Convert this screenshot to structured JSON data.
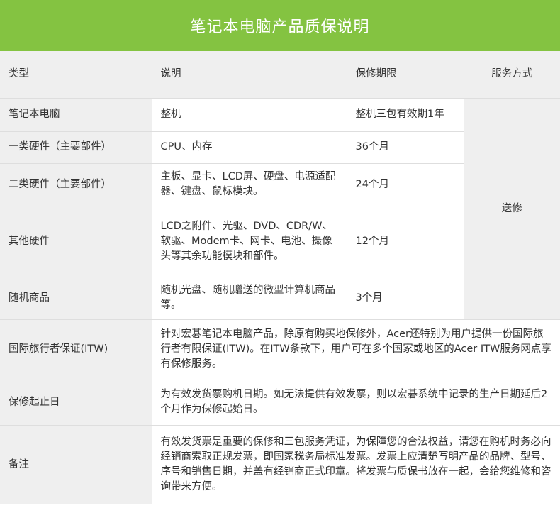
{
  "title": "笔记本电脑产品质保说明",
  "headers": {
    "type": "类型",
    "desc": "说明",
    "period": "保修期限",
    "service": "服务方式"
  },
  "rows": [
    {
      "type": "笔记本电脑",
      "desc": "整机",
      "period": "整机三包有效期1年"
    },
    {
      "type": "一类硬件（主要部件）",
      "desc": "CPU、内存",
      "period": "36个月"
    },
    {
      "type": "二类硬件（主要部件）",
      "desc": "主板、显卡、LCD屏、硬盘、电源适配器、键盘、鼠标模块。",
      "period": "24个月"
    },
    {
      "type": "其他硬件",
      "desc": "LCD之附件、光驱、DVD、CDR/W、软驱、Modem卡、网卡、电池、摄像头等其余功能模块和部件。",
      "period": "12个月"
    },
    {
      "type": "随机商品",
      "desc": "随机光盘、随机赠送的微型计算机商品等。",
      "period": "3个月"
    }
  ],
  "service": "送修",
  "notes": [
    {
      "label": "国际旅行者保证(ITW)",
      "text": "针对宏碁笔记本电脑产品，除原有购买地保修外，Acer还特别为用户提供一份国际旅行者有限保证(ITW)。在ITW条款下，用户可在多个国家或地区的Acer ITW服务网点享有保修服务。"
    },
    {
      "label": "保修起止日",
      "text": "为有效发货票购机日期。如无法提供有效发票，则以宏碁系统中记录的生产日期延后2个月作为保修起始日。"
    },
    {
      "label": "备注",
      "text": "有效发货票是重要的保修和三包服务凭证，为保障您的合法权益，请您在购机时务必向经销商索取正规发票，即国家税务局标准发票。发票上应清楚写明产品的品牌、型号、序号和销售日期，并盖有经销商正式印章。将发票与质保书放在一起，会给您维修和咨询带来方便。"
    }
  ]
}
